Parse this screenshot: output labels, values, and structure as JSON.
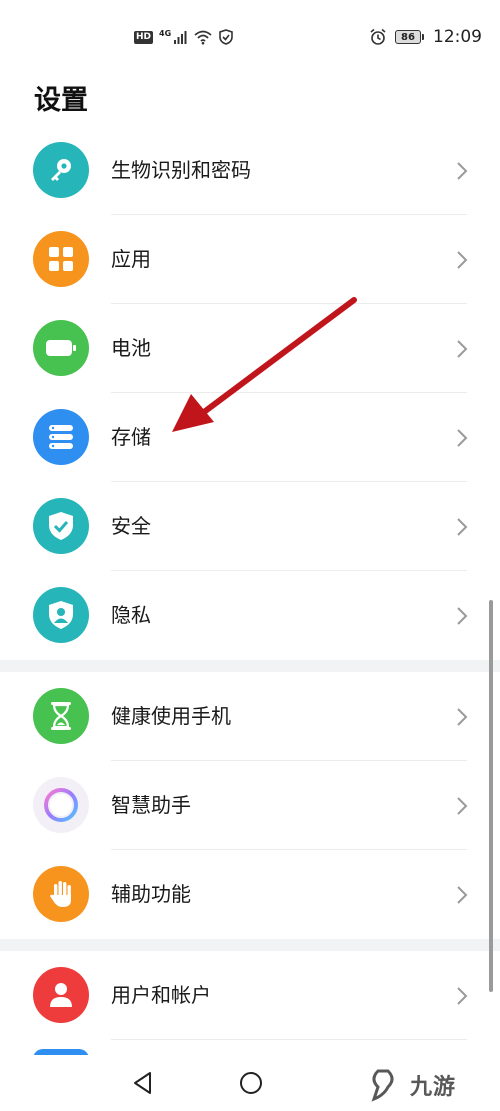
{
  "status_bar": {
    "hd": "HD",
    "network": "4G",
    "battery_level": "86",
    "time": "12:09"
  },
  "title": "设置",
  "groups": [
    {
      "items": [
        {
          "label": "生物识别和密码",
          "icon": "key-icon",
          "color": "#26b5b9"
        },
        {
          "label": "应用",
          "icon": "apps-grid-icon",
          "color": "#f7941d"
        },
        {
          "label": "电池",
          "icon": "battery-icon",
          "color": "#47c14f"
        },
        {
          "label": "存储",
          "icon": "storage-icon",
          "color": "#2f8ff0"
        },
        {
          "label": "安全",
          "icon": "shield-check-icon",
          "color": "#26b5b9"
        },
        {
          "label": "隐私",
          "icon": "privacy-shield-icon",
          "color": "#26b5b9"
        }
      ]
    },
    {
      "items": [
        {
          "label": "健康使用手机",
          "icon": "hourglass-icon",
          "color": "#47c14f"
        },
        {
          "label": "智慧助手",
          "icon": "assistant-orb-icon",
          "color": "#f2f0f6"
        },
        {
          "label": "辅助功能",
          "icon": "hand-icon",
          "color": "#f7941d"
        }
      ]
    },
    {
      "items": [
        {
          "label": "用户和帐户",
          "icon": "user-icon",
          "color": "#ee3b3b"
        }
      ]
    }
  ],
  "watermark": {
    "text": "九游"
  },
  "annotation_color": "#c0161b"
}
